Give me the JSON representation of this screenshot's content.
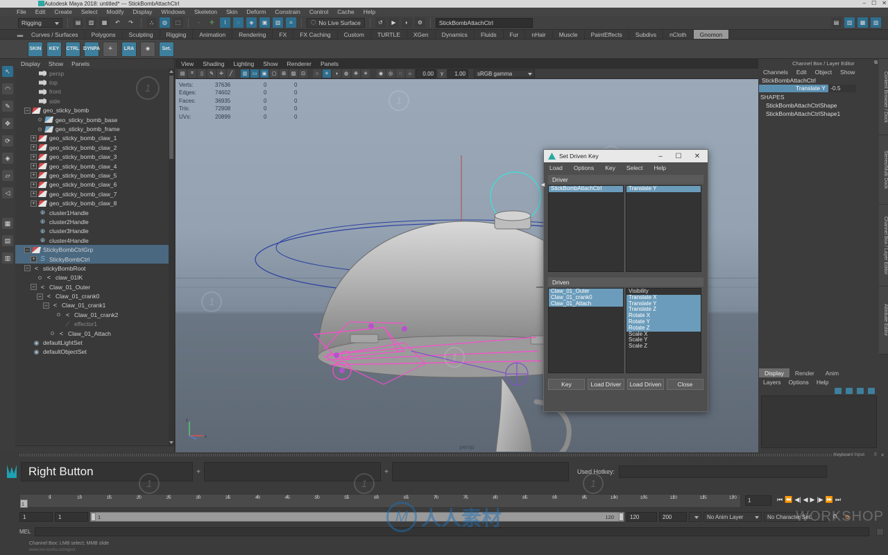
{
  "titlebar": {
    "text": "Autodesk Maya 2018: untitled*  ---  StickBombAttachCtrl",
    "minimize": "–",
    "maximize": "☐",
    "close": "✕"
  },
  "menubar": {
    "items": [
      "File",
      "Edit",
      "Create",
      "Select",
      "Modify",
      "Display",
      "Windows",
      "Skeleton",
      "Skin",
      "Deform",
      "Constrain",
      "Control",
      "Cache",
      "Help"
    ]
  },
  "statusline": {
    "mode": "Rigging",
    "snap_label": "No Live Surface",
    "field_value": "StickBombAttachCtrl",
    "icons": [
      "new-scene-icon",
      "open-scene-icon",
      "save-scene-icon",
      "undo-icon",
      "redo-icon",
      "select-hierarchy-icon",
      "select-object-icon",
      "select-component-icon",
      "snap-grid-icon",
      "snap-curve-icon",
      "snap-point-icon",
      "snap-projected-icon",
      "snap-view-icon",
      "construction-history-icon",
      "render-icon",
      "ipr-render-icon",
      "render-settings-icon"
    ]
  },
  "shelf": {
    "tabs": [
      "Curves / Surfaces",
      "Polygons",
      "Sculpting",
      "Rigging",
      "Animation",
      "Rendering",
      "FX",
      "FX Caching",
      "Custom",
      "TURTLE",
      "XGen",
      "Dynamics",
      "Fluids",
      "Fur",
      "nHair",
      "Muscle",
      "PaintEffects",
      "Subdivs",
      "nCloth",
      "Gnomon"
    ],
    "active_tab": "Gnomon",
    "buttons": [
      {
        "label": "SKIN",
        "name": "shelf-skin-button"
      },
      {
        "label": "KEY",
        "name": "shelf-key-button"
      },
      {
        "label": "CTRL",
        "name": "shelf-ctrl-button"
      },
      {
        "label": "DYNPA",
        "name": "shelf-dynpa-button"
      },
      {
        "label": "",
        "name": "shelf-icon-5"
      },
      {
        "label": "LRA",
        "name": "shelf-lra-button"
      },
      {
        "label": "",
        "name": "shelf-icon-7"
      },
      {
        "label": "Set.",
        "name": "shelf-set-button"
      }
    ]
  },
  "toolbox": {
    "items": [
      "select-tool",
      "lasso-tool",
      "paint-select-tool",
      "move-tool",
      "rotate-tool",
      "scale-tool",
      "last-tool",
      "show-manipulator-tool",
      "layout-single",
      "layout-four",
      "layout-two-stacked"
    ]
  },
  "outliner": {
    "menu": [
      "Display",
      "Show",
      "Panels"
    ],
    "rows": [
      {
        "label": "persp",
        "indent": 2,
        "icon": "camera-icon",
        "toggle": "none",
        "dim": true
      },
      {
        "label": "top",
        "indent": 2,
        "icon": "camera-icon",
        "toggle": "none",
        "dim": true
      },
      {
        "label": "front",
        "indent": 2,
        "icon": "camera-icon",
        "toggle": "none",
        "dim": true
      },
      {
        "label": "side",
        "indent": 2,
        "icon": "camera-icon",
        "toggle": "none",
        "dim": true
      },
      {
        "label": "geo_sticky_bomb",
        "indent": 1,
        "icon": "mesh-icon",
        "toggle": "minus"
      },
      {
        "label": "geo_sticky_bomb_base",
        "indent": 3,
        "icon": "mesh2-icon",
        "toggle": "dot"
      },
      {
        "label": "geo_sticky_bomb_frame",
        "indent": 3,
        "icon": "mesh2-icon",
        "toggle": "dot"
      },
      {
        "label": "geo_sticky_bomb_claw_1",
        "indent": 2,
        "icon": "mesh-icon",
        "toggle": "plus"
      },
      {
        "label": "geo_sticky_bomb_claw_2",
        "indent": 2,
        "icon": "mesh-icon",
        "toggle": "plus"
      },
      {
        "label": "geo_sticky_bomb_claw_3",
        "indent": 2,
        "icon": "mesh-icon",
        "toggle": "plus"
      },
      {
        "label": "geo_sticky_bomb_claw_4",
        "indent": 2,
        "icon": "mesh-icon",
        "toggle": "plus"
      },
      {
        "label": "geo_sticky_bomb_claw_5",
        "indent": 2,
        "icon": "mesh-icon",
        "toggle": "plus"
      },
      {
        "label": "geo_sticky_bomb_claw_6",
        "indent": 2,
        "icon": "mesh-icon",
        "toggle": "plus"
      },
      {
        "label": "geo_sticky_bomb_claw_7",
        "indent": 2,
        "icon": "mesh-icon",
        "toggle": "plus"
      },
      {
        "label": "geo_sticky_bomb_claw_8",
        "indent": 2,
        "icon": "mesh-icon",
        "toggle": "plus"
      },
      {
        "label": "cluster1Handle",
        "indent": 2,
        "icon": "cluster-icon",
        "toggle": "none"
      },
      {
        "label": "cluster2Handle",
        "indent": 2,
        "icon": "cluster-icon",
        "toggle": "none"
      },
      {
        "label": "cluster3Handle",
        "indent": 2,
        "icon": "cluster-icon",
        "toggle": "none"
      },
      {
        "label": "cluster4Handle",
        "indent": 2,
        "icon": "cluster-icon",
        "toggle": "none"
      },
      {
        "label": "StickyBombCtrlGrp",
        "indent": 1,
        "icon": "mesh-icon",
        "toggle": "minus",
        "selected": true
      },
      {
        "label": "StickyBombCtrl",
        "indent": 2,
        "icon": "curve-icon",
        "toggle": "plus",
        "selected": true
      },
      {
        "label": "stickyBombRoot",
        "indent": 1,
        "icon": "joint-icon",
        "toggle": "minus"
      },
      {
        "label": "claw_01IK",
        "indent": 3,
        "icon": "ik-icon",
        "toggle": "dot"
      },
      {
        "label": "Claw_01_Outer",
        "indent": 2,
        "icon": "joint-icon",
        "toggle": "minus"
      },
      {
        "label": "Claw_01_crank0",
        "indent": 3,
        "icon": "joint-icon",
        "toggle": "minus"
      },
      {
        "label": "Claw_01_crank1",
        "indent": 4,
        "icon": "joint-icon",
        "toggle": "minus"
      },
      {
        "label": "Claw_01_crank2",
        "indent": 6,
        "icon": "joint-icon",
        "toggle": "dot"
      },
      {
        "label": "effector1",
        "indent": 6,
        "icon": "effector-icon",
        "toggle": "none",
        "dim": true
      },
      {
        "label": "Claw_01_Attach",
        "indent": 5,
        "icon": "joint-icon",
        "toggle": "dot"
      },
      {
        "label": "defaultLightSet",
        "indent": 1,
        "icon": "set-icon",
        "toggle": "none"
      },
      {
        "label": "defaultObjectSet",
        "indent": 1,
        "icon": "set-icon",
        "toggle": "none"
      }
    ]
  },
  "viewport": {
    "menu": [
      "View",
      "Shading",
      "Lighting",
      "Show",
      "Renderer",
      "Panels"
    ],
    "exposure": "0.00",
    "gamma_value": "1.00",
    "color_space": "sRGB gamma",
    "camera_label": "persp",
    "hud": {
      "rows": [
        {
          "key": "Verts:",
          "value": "37636",
          "a": "0",
          "b": "0"
        },
        {
          "key": "Edges:",
          "value": "74602",
          "a": "0",
          "b": "0"
        },
        {
          "key": "Faces:",
          "value": "36935",
          "a": "0",
          "b": "0"
        },
        {
          "key": "Tris:",
          "value": "72908",
          "a": "0",
          "b": "0"
        },
        {
          "key": "UVs:",
          "value": "20899",
          "a": "0",
          "b": "0"
        }
      ]
    }
  },
  "channelbox": {
    "panel_title": "Channel Box / Layer Editor",
    "menu": [
      "Channels",
      "Edit",
      "Object",
      "Show"
    ],
    "node": "StickBombAttachCtrl",
    "attributes": [
      {
        "name": "Translate Y",
        "value": "-0.5"
      }
    ],
    "shapes_label": "SHAPES",
    "shapes": [
      "StickBombAttachCtrlShape",
      "StickBombAttachCtrlShape1"
    ],
    "side_tabs": [
      "Content Browser / Dock",
      "Stereo/Multi Dock",
      "Channel Box / Layer Editor",
      "Attribute Editor"
    ]
  },
  "layereditor": {
    "tabs": [
      "Display",
      "Render",
      "Anim"
    ],
    "active_tab": "Display",
    "menu": [
      "Layers",
      "Options",
      "Help"
    ]
  },
  "keyboard_input": {
    "header_label": "Keyboard Input",
    "field1": "Right Button",
    "field2": "",
    "field3": "",
    "plus": "+",
    "hotkey_label": "Used Hotkey:",
    "hotkey_value": ""
  },
  "timeslider": {
    "ticks": [
      "5",
      "10",
      "15",
      "20",
      "25",
      "30",
      "35",
      "40",
      "45",
      "50",
      "55",
      "60",
      "65",
      "70",
      "75",
      "80",
      "85",
      "90",
      "95",
      "100",
      "105",
      "110",
      "115",
      "120"
    ],
    "current_frame": "1",
    "frame_field": "1",
    "transport_icons": [
      "go-to-start",
      "step-back-key",
      "step-back-frame",
      "play-backwards",
      "play-forwards",
      "step-forward-frame",
      "step-forward-key",
      "go-to-end"
    ]
  },
  "rangeslider": {
    "anim_start": "1",
    "range_start": "1",
    "track_start": "1",
    "track_end": "120",
    "range_end": "120",
    "anim_end": "200",
    "anim_layer": "No Anim Layer",
    "character_set": "No Character Set."
  },
  "commandline": {
    "label": "MEL",
    "value": "",
    "help_text": "Channel Box: LMB select; MMB slide",
    "help_text2": "www.ren-works.cn/ingest"
  },
  "sdk_dialog": {
    "title": "Set Driven Key",
    "minimize": "–",
    "maximize": "☐",
    "close": "✕",
    "menu": [
      "Load",
      "Options",
      "Key",
      "Select",
      "Help"
    ],
    "driver_label": "Driver",
    "driver_objects": [
      {
        "label": "StickBombAttachCtrl",
        "selected": true
      }
    ],
    "driver_attributes": [
      {
        "label": "Translate Y",
        "selected": true
      }
    ],
    "driven_label": "Driven",
    "driven_objects": [
      {
        "label": "Claw_01_Outer",
        "selected": true
      },
      {
        "label": "Claw_01_crank0",
        "selected": true
      },
      {
        "label": "Claw_01_Attach",
        "selected": true
      }
    ],
    "driven_attributes": [
      {
        "label": "Visibility",
        "selected": false
      },
      {
        "label": "Translate X",
        "selected": true
      },
      {
        "label": "Translate Y",
        "selected": true
      },
      {
        "label": "Translate Z",
        "selected": true
      },
      {
        "label": "Rotate X",
        "selected": true
      },
      {
        "label": "Rotate Y",
        "selected": true
      },
      {
        "label": "Rotate Z",
        "selected": true
      },
      {
        "label": "Scale X",
        "selected": false
      },
      {
        "label": "Scale Y",
        "selected": false
      },
      {
        "label": "Scale Z",
        "selected": false
      }
    ],
    "buttons": [
      "Key",
      "Load Driver",
      "Load Driven",
      "Close"
    ]
  },
  "watermarks": {
    "center_text": "人人素材",
    "center_mark": "M",
    "right_text": "WORKSHOP"
  },
  "colors": {
    "accent": "#2e6e8e",
    "selection": "#4a6880",
    "list_selection": "#6b9cbb",
    "channel_attr": "#5b8fb0",
    "watermark_blue": "#1f6fb5"
  }
}
